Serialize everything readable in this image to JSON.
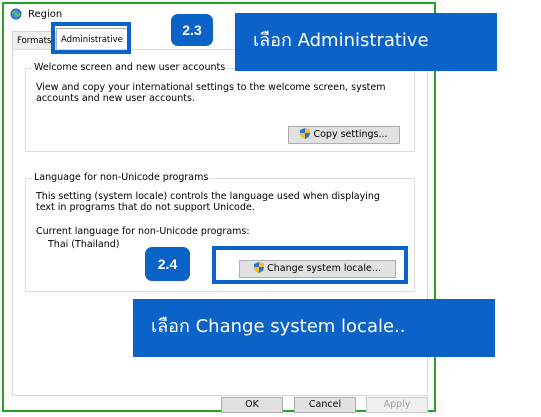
{
  "window": {
    "title": "Region"
  },
  "tabs": [
    {
      "label": "Formats"
    },
    {
      "label": "Administrative"
    }
  ],
  "welcome_group": {
    "legend": "Welcome screen and new user accounts",
    "description_line1": "View and copy your international settings to the welcome screen, system",
    "description_line2": "accounts and new user accounts.",
    "copy_button": "Copy settings..."
  },
  "unicode_group": {
    "legend": "Language for non-Unicode programs",
    "description_line1": "This setting (system locale) controls the language used when displaying",
    "description_line2": "text in programs that do not support Unicode.",
    "current_label": "Current language for non-Unicode programs:",
    "current_value": "Thai (Thailand)",
    "change_button": "Change system locale..."
  },
  "footer": {
    "ok": "OK",
    "cancel": "Cancel",
    "apply": "Apply"
  },
  "annotations": {
    "step_a": "2.3",
    "step_b": "2.4",
    "callout_a": "เลือก Administrative",
    "callout_b": "เลือก Change system locale.."
  },
  "colors": {
    "accent": "#0c63c7",
    "window_border": "#25a325"
  }
}
